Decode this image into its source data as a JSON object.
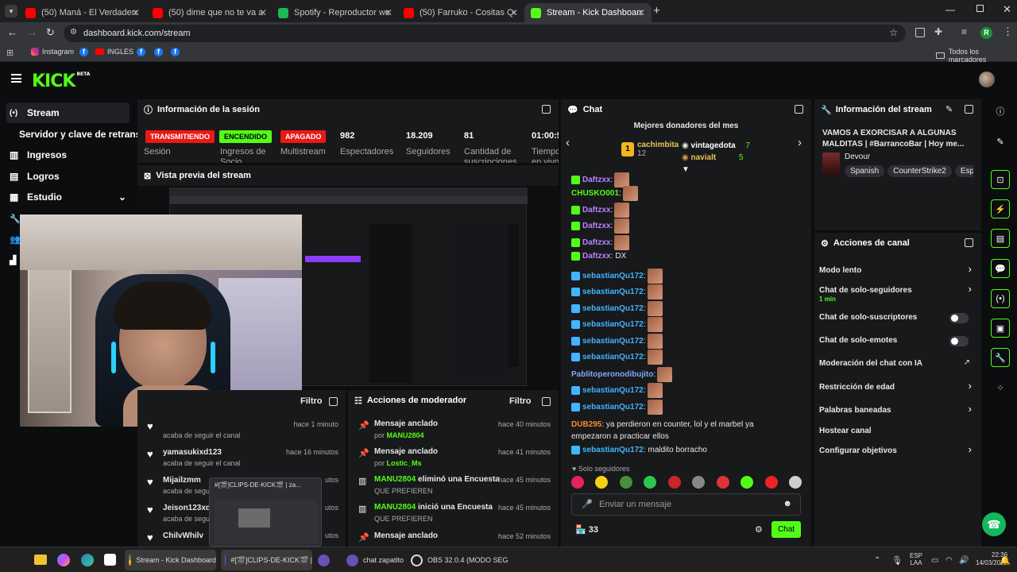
{
  "browser": {
    "tabs": [
      {
        "label": "(50) Maná - El Verdadero Amor",
        "icon": "youtube-icon"
      },
      {
        "label": "(50) dime que no te va a ir yo t",
        "icon": "youtube-icon"
      },
      {
        "label": "Spotify - Reproductor web: mú",
        "icon": "spotify-icon"
      },
      {
        "label": "(50) Farruko - Cositas Que Hac",
        "icon": "youtube-icon"
      },
      {
        "label": "Stream - Kick Dashboard",
        "icon": "kick-icon"
      }
    ],
    "url": "dashboard.kick.com/stream",
    "bookmarks": [
      "Instagram",
      "INGLES"
    ],
    "all_bookmarks": "Todos los marcadores",
    "profile_initial": "R"
  },
  "kick": {
    "logo": "KICK",
    "logo_beta": "BETA",
    "sidebar": [
      {
        "label": "Stream",
        "icon": "stream-icon"
      },
      {
        "label": "Servidor y clave de retransm",
        "icon": ""
      },
      {
        "label": "Ingresos",
        "icon": "income-icon"
      },
      {
        "label": "Logros",
        "icon": "achievements-icon"
      },
      {
        "label": "Estudio",
        "icon": "studio-icon"
      }
    ],
    "session": {
      "title": "Información de la sesión",
      "badges": [
        {
          "text": "TRANSMITIENDO",
          "label": "Sesión",
          "color": "#e91916"
        },
        {
          "text": "ENCENDIDO",
          "label": "Ingresos de Socio",
          "color": "#53fc18"
        },
        {
          "text": "APAGADO",
          "label": "Multistream",
          "color": "#e91916"
        }
      ],
      "stats": [
        {
          "value": "982",
          "label": "Espectadores"
        },
        {
          "value": "18.209",
          "label": "Seguidores"
        },
        {
          "value": "81",
          "label": "Cantidad de suscripciones"
        },
        {
          "value": "01:00:5",
          "label": "Tiempo en vivo"
        }
      ]
    },
    "preview": {
      "title": "Vista previa del stream"
    },
    "followers_panel": {
      "filter": "Filtro",
      "rows": [
        {
          "name": "",
          "sub": "acaba de seguir el canal",
          "time": "hace 1 minuto"
        },
        {
          "name": "yamasukixd123",
          "sub": "acaba de seguir el canal",
          "time": "hace 16 minutos"
        },
        {
          "name": "Mijailzmm",
          "sub": "acaba de segu",
          "time": "utos"
        },
        {
          "name": "Jeison123xd",
          "sub": "acaba de segu",
          "time": "utos"
        },
        {
          "name": "ChilvWhilv",
          "sub": "",
          "time": "utos"
        }
      ]
    },
    "mod_actions": {
      "title": "Acciones de moderador",
      "filter": "Filtro",
      "rows": [
        {
          "title": "Mensaje anclado",
          "prefix": "por",
          "user": "MANU2804",
          "time": "hace 40 minutos",
          "icon": "pin-icon"
        },
        {
          "title": "Mensaje anclado",
          "prefix": "por",
          "user": "Lostic_Ms",
          "time": "hace 41 minutos",
          "icon": "pin-icon"
        },
        {
          "title": "eliminó una Encuesta",
          "prefix": "QUE PREFIEREN",
          "user": "MANU2804",
          "time": "hace 45 minutos",
          "icon": "poll-icon"
        },
        {
          "title": "inició una Encuesta",
          "prefix": "QUE PREFIEREN",
          "user": "MANU2804",
          "time": "hace 45 minutos",
          "icon": "poll-icon"
        },
        {
          "title": "Mensaje anclado",
          "prefix": "",
          "user": "",
          "time": "hace 52 minutos",
          "icon": "pin-icon"
        }
      ]
    },
    "chat": {
      "title": "Chat",
      "donors_title": "Mejores donadores del mes",
      "donors": [
        {
          "rank": "1",
          "name": "cachimbita",
          "amount": "12"
        },
        {
          "rank": "",
          "name": "vintagedota",
          "amount": "7"
        },
        {
          "rank": "",
          "name": "navialt",
          "amount": "5"
        }
      ],
      "messages": [
        {
          "user": "Daftzxx",
          "text": "",
          "emotes": 1,
          "color": "#b982ff",
          "badge": "#53fc18"
        },
        {
          "user": "CHUSKO001",
          "text": "",
          "emotes": 1,
          "color": "#53fc18",
          "badge": ""
        },
        {
          "user": "Daftzxx",
          "text": "",
          "emotes": 1,
          "color": "#b982ff",
          "badge": "#53fc18"
        },
        {
          "user": "Daftzxx",
          "text": "",
          "emotes": 1,
          "color": "#b982ff",
          "badge": "#53fc18"
        },
        {
          "user": "Daftzxx",
          "text": "",
          "emotes": 1,
          "color": "#b982ff",
          "badge": "#53fc18"
        },
        {
          "user": "Daftzxx",
          "text": "DX",
          "emotes": 0,
          "color": "#b982ff",
          "badge": "#53fc18"
        },
        {
          "user": "sebastianQu172",
          "text": "",
          "emotes": 1,
          "color": "#3fb6ff",
          "badge": "#3fb6ff"
        },
        {
          "user": "sebastianQu172",
          "text": "",
          "emotes": 1,
          "color": "#3fb6ff",
          "badge": "#3fb6ff"
        },
        {
          "user": "sebastianQu172",
          "text": "",
          "emotes": 1,
          "color": "#3fb6ff",
          "badge": "#3fb6ff"
        },
        {
          "user": "sebastianQu172",
          "text": "",
          "emotes": 1,
          "color": "#3fb6ff",
          "badge": "#3fb6ff"
        },
        {
          "user": "sebastianQu172",
          "text": "",
          "emotes": 1,
          "color": "#3fb6ff",
          "badge": "#3fb6ff"
        },
        {
          "user": "sebastianQu172",
          "text": "",
          "emotes": 1,
          "color": "#3fb6ff",
          "badge": "#3fb6ff"
        },
        {
          "user": "Pablitoperonodibujito",
          "text": "",
          "emotes": 1,
          "color": "#7fa7ff",
          "badge": ""
        },
        {
          "user": "sebastianQu172",
          "text": "",
          "emotes": 1,
          "color": "#3fb6ff",
          "badge": "#3fb6ff"
        },
        {
          "user": "sebastianQu172",
          "text": "",
          "emotes": 1,
          "color": "#3fb6ff",
          "badge": "#3fb6ff"
        }
      ],
      "long_message": {
        "user": "DUB295",
        "text": "ya perdieron en counter, lol y el marbel ya empezaron a practicar ellos"
      },
      "last_message": {
        "user": "sebastianQu172",
        "text": "maldito borracho"
      },
      "mode_label": "Solo seguidores",
      "input_placeholder": "Enviar un mensaje",
      "viewers": "33",
      "send_label": "Chat"
    },
    "stream_info": {
      "title": "Información del stream",
      "stream_title": "VAMOS A EXORCISAR A ALGUNAS MALDITAS | #BarrancoBar | Hoy me...",
      "category": "Devour",
      "tags": [
        "Spanish",
        "CounterStrike2",
        "Espa"
      ]
    },
    "channel_actions": {
      "title": "Acciones de canal",
      "items": [
        {
          "label": "Modo lento",
          "sub": "",
          "control": "chevron"
        },
        {
          "label": "Chat de solo-seguidores",
          "sub": "1 min",
          "control": "chevron"
        },
        {
          "label": "Chat de solo-suscriptores",
          "sub": "",
          "control": "toggle"
        },
        {
          "label": "Chat de solo-emotes",
          "sub": "",
          "control": "toggle"
        },
        {
          "label": "Moderación del chat con IA",
          "sub": "",
          "control": "external"
        },
        {
          "label": "Restricción de edad",
          "sub": "",
          "control": "chevron"
        },
        {
          "label": "Palabras baneadas",
          "sub": "",
          "control": "chevron"
        },
        {
          "label": "Hostear canal",
          "sub": "",
          "control": ""
        },
        {
          "label": "Configurar objetivos",
          "sub": "",
          "control": "chevron"
        }
      ]
    }
  },
  "discord_preview": {
    "title": "#[🎬]CLIPS-DE-KICK🎬 | za..."
  },
  "taskbar": {
    "items": [
      {
        "label": "Stream - Kick Dashboard"
      },
      {
        "label": "#[🎬]CLIPS-DE-KICK🎬 |"
      },
      {
        "label": "chat zapatito"
      },
      {
        "label": "OBS 32.0.4 (MODO SEG"
      }
    ],
    "lang": "ESP",
    "lang2": "LAA",
    "time": "22:36",
    "date": "14/03/2026"
  }
}
